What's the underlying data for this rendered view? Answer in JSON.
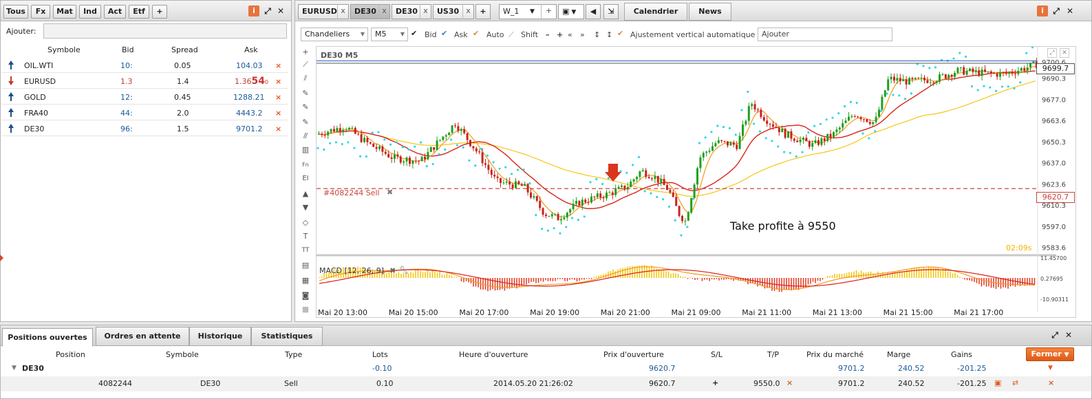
{
  "watchlist_panel": {
    "filters": [
      "Tous",
      "Fx",
      "Mat",
      "Ind",
      "Act",
      "Etf",
      "+"
    ],
    "add_label": "Ajouter:",
    "add_placeholder": "",
    "columns": {
      "symbol": "Symbole",
      "bid": "Bid",
      "spread": "Spread",
      "ask": "Ask"
    },
    "rows": [
      {
        "symbol": "OIL.WTI",
        "direction": "up",
        "bid": "10:",
        "spread": "0.05",
        "ask": "104.03"
      },
      {
        "symbol": "EURUSD",
        "direction": "down",
        "bid": "1.3",
        "spread": "1.4",
        "ask_prefix": "1.36",
        "ask_big": "54",
        "ask_suffix": "0"
      },
      {
        "symbol": "GOLD",
        "direction": "up",
        "bid": "12:",
        "spread": "0.45",
        "ask": "1288.21"
      },
      {
        "symbol": "FRA40",
        "direction": "up",
        "bid": "44:",
        "spread": "2.0",
        "ask": "4443.2"
      },
      {
        "symbol": "DE30",
        "direction": "up",
        "bid": "96:",
        "spread": "1.5",
        "ask": "9701.2"
      }
    ]
  },
  "chart_panel": {
    "tabs": [
      {
        "label": "EURUSD",
        "active": false
      },
      {
        "label": "DE30",
        "active": true
      },
      {
        "label": "DE30",
        "active": false
      },
      {
        "label": "US30",
        "active": false
      }
    ],
    "tab_close": "x",
    "add_tab": "+",
    "workspace": "W_1",
    "workspace_add": "+",
    "calendar": "Calendrier",
    "news": "News",
    "toolbar": {
      "chart_type": "Chandeliers",
      "timeframe": "M5",
      "bid": "Bid",
      "ask": "Ask",
      "auto": "Auto",
      "shift": "Shift",
      "auto_scale": "Ajustement vertical automatique",
      "add_input": "Ajouter"
    },
    "chart_title": "DE30 M5",
    "order_label": "#4082244 Sell",
    "annotation": "Take profite à 9550",
    "timer": "02:09s",
    "macd_label": "MACD [12, 26, 9]",
    "price_labels": [
      "9700.6",
      "9690.3",
      "9677.0",
      "9663.6",
      "9650.3",
      "9637.0",
      "9623.6",
      "9610.3",
      "9597.0",
      "9583.6"
    ],
    "current_price": "9699.7",
    "order_price": "9620.7",
    "macd_labels": [
      "11.45700",
      "0.27695",
      "-10.90311"
    ],
    "time_labels": [
      "Mai 20 13:00",
      "Mai 20 15:00",
      "Mai 20 17:00",
      "Mai 20 19:00",
      "Mai 20 21:00",
      "Mai 21 09:00",
      "Mai 21 11:00",
      "Mai 21 13:00",
      "Mai 21 15:00",
      "Mai 21 17:00"
    ],
    "colors": {
      "bull": "#1fa01f",
      "bear": "#c8241c",
      "sar": "#33d6e6",
      "ma_fast": "#f29a1d",
      "ma_mid": "#d9221a",
      "ma_slow": "#f5c518"
    }
  },
  "bottom_panel": {
    "tabs": [
      "Positions ouvertes",
      "Ordres en attente",
      "Historique",
      "Statistiques"
    ],
    "columns": [
      "Position",
      "Symbole",
      "Type",
      "Lots",
      "Heure d'ouverture",
      "Prix d'ouverture",
      "S/L",
      "T/P",
      "Prix du marché",
      "Marge",
      "Gains"
    ],
    "close_button": "Fermer",
    "group": {
      "symbol": "DE30",
      "lots": "-0.10",
      "open_price": "9620.7",
      "market_price": "9701.2",
      "margin": "240.52",
      "gains": "-201.25"
    },
    "position": {
      "id": "4082244",
      "symbol": "DE30",
      "type": "Sell",
      "lots": "0.10",
      "open_time": "2014.05.20 21:26:02",
      "open_price": "9620.7",
      "sl": "+",
      "tp": "9550.0",
      "market_price": "9701.2",
      "margin": "240.52",
      "gains": "-201.25"
    }
  }
}
